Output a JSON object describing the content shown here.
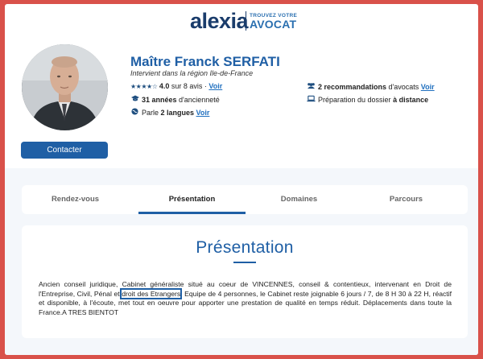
{
  "header": {
    "logo_word": "alexia",
    "logo_tagline_small": "TROUVEZ VOTRE",
    "logo_tagline_big": "AVOCAT"
  },
  "profile": {
    "name": "Maître Franck SERFATI",
    "subtitle": "Intervient dans la région Ile-de-France",
    "rating_value": "4.0",
    "rating_rest": " sur 8 avis · ",
    "rating_link": "Voir",
    "rating_stars": 4,
    "experience_value": "31 années",
    "experience_rest": " d'ancienneté",
    "languages_prefix": "Parle ",
    "languages_value": "2 langues",
    "languages_link": "Voir",
    "recommendations_value": "2 recommandations",
    "recommendations_rest": " d'avocats ",
    "recommendations_link": "Voir",
    "preparation_prefix": "Préparation du dossier ",
    "preparation_value": "à distance",
    "contact_button": "Contacter"
  },
  "tabs": [
    {
      "label": "Rendez-vous",
      "active": false
    },
    {
      "label": "Présentation",
      "active": true
    },
    {
      "label": "Domaines",
      "active": false
    },
    {
      "label": "Parcours",
      "active": false
    }
  ],
  "presentation": {
    "title": "Présentation",
    "text_before": "Ancien conseil juridique, Cabinet généraliste situé au coeur de VINCENNES, conseil & contentieux, intervenant en Droit de l'Entreprise, Civil, Pénal et ",
    "text_highlight": "droit des Etrangers",
    "text_after": ". Equipe de 4 personnes, le Cabinet reste joignable 6 jours / 7, de 8 H 30 à 22 H, réactif et disponible, à l'écoute, met tout en oeuvre pour apporter une prestation de qualité en temps réduit. Déplacements dans toute la France.A TRES BIENTOT"
  },
  "colors": {
    "frame_border": "#d9514a",
    "accent": "#1f5fa5",
    "logo_dark": "#1a3c6b"
  }
}
